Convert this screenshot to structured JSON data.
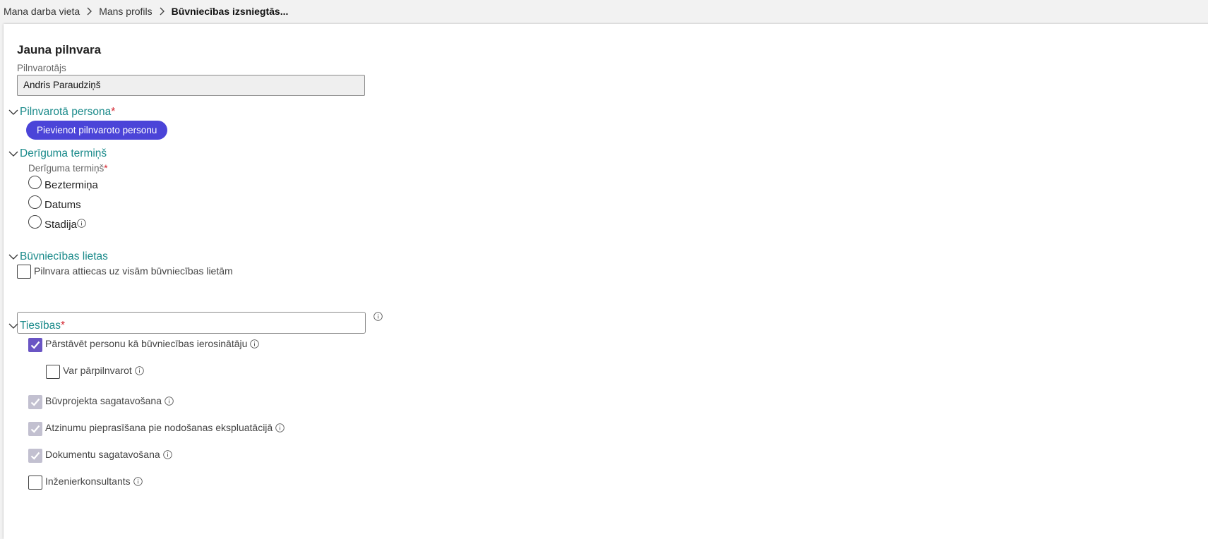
{
  "breadcrumb": {
    "items": [
      "Mana darba vieta",
      "Mans profils"
    ],
    "current": "Būvniecības izsniegtās..."
  },
  "form": {
    "title": "Jauna pilnvara",
    "grantor": {
      "label": "Pilnvarotājs",
      "value": "Andris Paraudziņš"
    },
    "authorized_person": {
      "title": "Pilnvarotā persona",
      "required_mark": "*",
      "add_button": "Pievienot pilnvaroto personu"
    },
    "validity": {
      "title": "Derīguma termiņš",
      "field_label": "Derīguma termiņš",
      "required_mark": "*",
      "options": [
        "Beztermiņa",
        "Datums",
        "Stadija"
      ],
      "selected": null
    },
    "construction_cases": {
      "title": "Būvniecības lietas",
      "all_cases_label": "Pilnvara attiecas uz visām būvniecības lietām",
      "all_cases_checked": false,
      "search_value": ""
    },
    "rights": {
      "title": "Tiesības",
      "required_mark": "*",
      "items": [
        {
          "label": "Pārstāvēt personu kā būvniecības ierosinātāju",
          "checked": true,
          "disabled": false
        },
        {
          "label": "Var pārpilnvarot",
          "checked": false,
          "disabled": false
        },
        {
          "label": "Būvprojekta sagatavošana",
          "checked": true,
          "disabled": true
        },
        {
          "label": "Atzinumu pieprasīšana pie nodošanas ekspluatācijā",
          "checked": true,
          "disabled": true
        },
        {
          "label": "Dokumentu sagatavošana",
          "checked": true,
          "disabled": true
        },
        {
          "label": "Inženierkonsultants",
          "checked": false,
          "disabled": false
        }
      ]
    }
  },
  "colors": {
    "accent_teal": "#1a8a8a",
    "primary_button": "#4b44d8",
    "required": "#d2222d",
    "checkbox_checked": "#6a55c4",
    "checkbox_disabled": "#c2c0d0"
  }
}
